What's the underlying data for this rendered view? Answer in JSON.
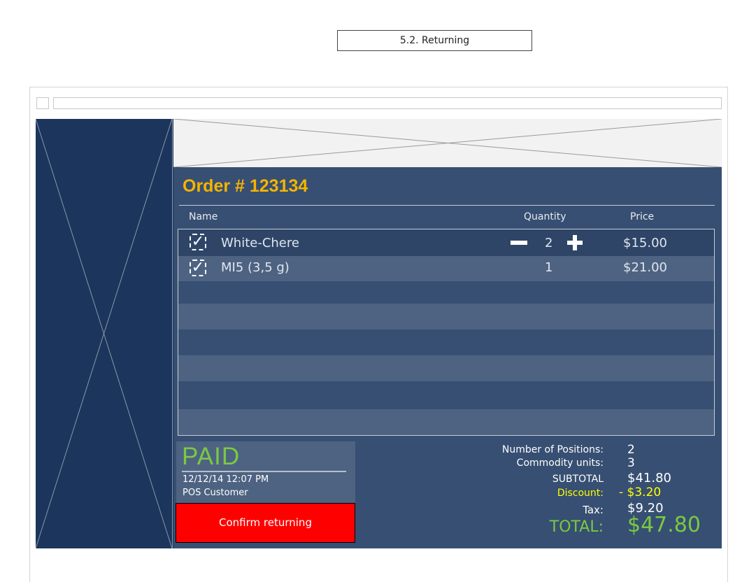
{
  "page_title": "5.2. Returning",
  "order": {
    "title": "Order # 123134"
  },
  "table": {
    "headers": {
      "name": "Name",
      "quantity": "Quantity",
      "price": "Price"
    },
    "rows": [
      {
        "checked": true,
        "name": "White-Chere",
        "quantity": "2",
        "price": "$15.00"
      },
      {
        "checked": true,
        "name": "MI5 (3,5 g)",
        "quantity": "1",
        "price": "$21.00"
      }
    ],
    "empty_row_count": 6
  },
  "status": {
    "label": "PAID",
    "date": "12/12/14  12:07 PM",
    "customer": "POS Customer"
  },
  "actions": {
    "confirm_label": "Confirm returning"
  },
  "summary": {
    "positions_label": "Number of Positions:",
    "positions_value": "2",
    "units_label": "Commodity units:",
    "units_value": "3",
    "subtotal_label": "SUBTOTAL",
    "subtotal_value": "$41.80",
    "discount_label": "Discount:",
    "discount_value": "- $3.20",
    "tax_label": "Tax:",
    "tax_value": "$9.20",
    "total_label": "TOTAL:",
    "total_value": "$47.80"
  },
  "colors": {
    "accent_title": "#f5b400",
    "paid_green": "#7ac943",
    "discount_yellow": "#ffff00",
    "confirm_red": "#ff0000",
    "panel_navy": "#374f72"
  },
  "icons": {
    "checkbox": "checkbox-checked-icon",
    "decrease": "minus-icon",
    "increase": "plus-icon"
  }
}
